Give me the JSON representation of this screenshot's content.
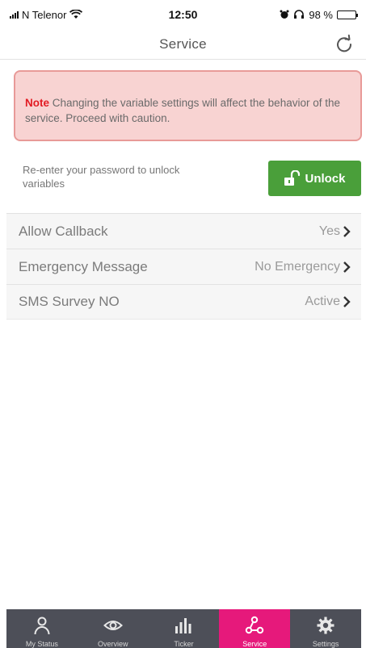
{
  "status_bar": {
    "carrier": "N Telenor",
    "time": "12:50",
    "battery_percent": "98 %",
    "battery_level": 0.98
  },
  "header": {
    "title": "Service",
    "refresh_icon": "refresh-icon"
  },
  "note": {
    "label": "Note",
    "text": "Changing the variable settings will affect the behavior of the service. Proceed with caution."
  },
  "unlock": {
    "hint": "Re-enter your password to unlock variables",
    "button_label": "Unlock",
    "icon": "unlock-icon"
  },
  "settings": [
    {
      "label": "Allow Callback",
      "value": "Yes"
    },
    {
      "label": "Emergency Message",
      "value": "No Emergency"
    },
    {
      "label": "SMS Survey NO",
      "value": "Active"
    }
  ],
  "tabs": [
    {
      "label": "My Status",
      "icon": "person-icon",
      "active": false
    },
    {
      "label": "Overview",
      "icon": "eye-icon",
      "active": false
    },
    {
      "label": "Ticker",
      "icon": "bar-chart-icon",
      "active": false
    },
    {
      "label": "Service",
      "icon": "network-icon",
      "active": true
    },
    {
      "label": "Settings",
      "icon": "gear-icon",
      "active": false
    }
  ],
  "colors": {
    "accent": "#e6197b",
    "unlock_green": "#4a9f3a",
    "note_bg": "#f8d3d2",
    "note_border": "#e89a98",
    "note_label": "#e21b23",
    "tabbar_bg": "#4d4f58"
  }
}
